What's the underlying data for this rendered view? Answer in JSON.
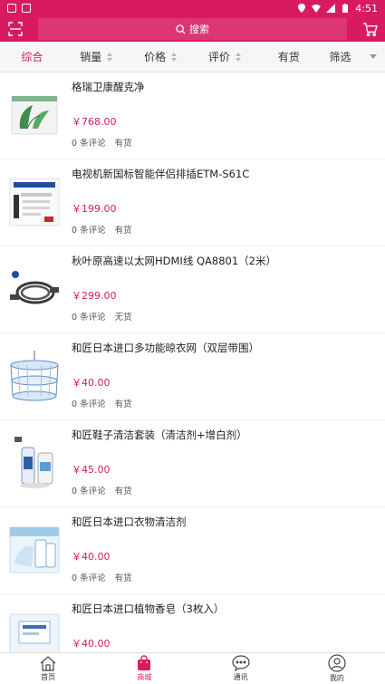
{
  "colors": {
    "accent": "#d81b60",
    "price": "#d81b60"
  },
  "status_bar": {
    "time": "4:51",
    "icons": [
      "notification-icon",
      "app-icon",
      "location-icon",
      "wifi-icon",
      "signal-icon",
      "battery-icon"
    ]
  },
  "header": {
    "search_label": "搜索",
    "left_icon": "scan-icon",
    "right_icon": "cart-icon"
  },
  "filters": [
    {
      "label": "综合",
      "active": true
    },
    {
      "label": "销量"
    },
    {
      "label": "价格"
    },
    {
      "label": "评价"
    },
    {
      "label": "有货"
    },
    {
      "label": "筛选"
    }
  ],
  "products": [
    {
      "title": "格瑞卫康醒克净",
      "price": "￥768.00",
      "reviews": "0 条评论",
      "stock": "有货",
      "image": "plant-box-product"
    },
    {
      "title": "电视机新国标智能伴侣排插ETM-S61C",
      "price": "￥199.00",
      "reviews": "0 条评论",
      "stock": "有货",
      "image": "power-strip-product"
    },
    {
      "title": "秋叶原高速以太网HDMI线 QA8801（2米）",
      "price": "￥299.00",
      "reviews": "0 条评论",
      "stock": "无货",
      "image": "hdmi-cable-product"
    },
    {
      "title": "和匠日本进口多功能晾衣网（双层带围）",
      "price": "￥40.00",
      "reviews": "0 条评论",
      "stock": "有货",
      "image": "drying-net-product"
    },
    {
      "title": "和匠鞋子清洁套装（清洁剂+增白剂）",
      "price": "￥45.00",
      "reviews": "0 条评论",
      "stock": "有货",
      "image": "shoe-cleaner-product"
    },
    {
      "title": "和匠日本进口衣物清洁剂",
      "price": "￥40.00",
      "reviews": "0 条评论",
      "stock": "有货",
      "image": "laundry-detergent-product"
    },
    {
      "title": "和匠日本进口植物香皂（3枚入）",
      "price": "￥40.00",
      "reviews": "",
      "stock": "",
      "image": "soap-product"
    }
  ],
  "bottom_nav": [
    {
      "label": "首页",
      "icon": "home-icon"
    },
    {
      "label": "商城",
      "icon": "shopping-bag-icon",
      "active": true
    },
    {
      "label": "通讯",
      "icon": "chat-icon"
    },
    {
      "label": "我的",
      "icon": "user-icon"
    }
  ]
}
